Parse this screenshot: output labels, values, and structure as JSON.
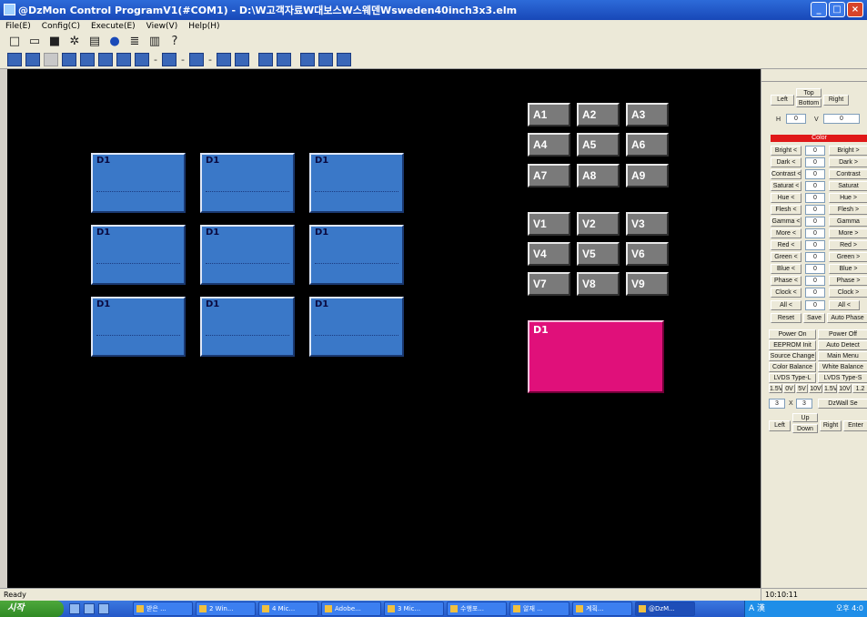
{
  "window": {
    "title": "@DzMon Control ProgramV1(#COM1) - D:\\W고객자료W대보스W스웨덴Wsweden40inch3x3.elm",
    "controls": [
      "_",
      "□",
      "×"
    ]
  },
  "menu": [
    "File(E)",
    "Config(C)",
    "Execute(E)",
    "View(V)",
    "Help(H)"
  ],
  "toolbar1_icons": [
    "new-icon",
    "open-icon",
    "save-icon",
    "tools-icon",
    "window-icon",
    "record-icon",
    "screen-icon",
    "monitor-icon",
    "help-icon"
  ],
  "toolbar1_glyphs": [
    "□",
    "▭",
    "■",
    "✲",
    "▤",
    "●",
    "≣",
    "▥",
    "?"
  ],
  "toolbar2": {
    "separators": [
      "-",
      "-",
      "-"
    ]
  },
  "display_panels": [
    {
      "label": "D1"
    },
    {
      "label": "D1"
    },
    {
      "label": "D1"
    },
    {
      "label": "D1"
    },
    {
      "label": "D1"
    },
    {
      "label": "D1"
    },
    {
      "label": "D1"
    },
    {
      "label": "D1"
    },
    {
      "label": "D1"
    }
  ],
  "a_grid": [
    "A1",
    "A2",
    "A3",
    "A4",
    "A5",
    "A6",
    "A7",
    "A8",
    "A9"
  ],
  "v_grid": [
    "V1",
    "V2",
    "V3",
    "V4",
    "V5",
    "V6",
    "V7",
    "V8",
    "V9"
  ],
  "selected_panel": {
    "label": "D1",
    "color": "#e0107a"
  },
  "right_panel": {
    "pos_buttons": {
      "left": "Left",
      "top": "Top",
      "bottom": "Bottom",
      "right": "Right"
    },
    "h_label": "H",
    "h_value": "0",
    "v_label": "V",
    "v_value": "0",
    "color_header": "Color",
    "adjust_rows": [
      {
        "minus": "Bright <",
        "value": "0",
        "plus": "Bright >"
      },
      {
        "minus": "Dark <",
        "value": "0",
        "plus": "Dark >"
      },
      {
        "minus": "Contrast <",
        "value": "0",
        "plus": "Contrast"
      },
      {
        "minus": "Saturat <",
        "value": "0",
        "plus": "Saturat"
      },
      {
        "minus": "Hue <",
        "value": "0",
        "plus": "Hue >"
      },
      {
        "minus": "Flesh <",
        "value": "0",
        "plus": "Flesh >"
      },
      {
        "minus": "Gamma <",
        "value": "0",
        "plus": "Gamma"
      },
      {
        "minus": "More <",
        "value": "0",
        "plus": "More >"
      },
      {
        "minus": "Red <",
        "value": "0",
        "plus": "Red >"
      },
      {
        "minus": "Green <",
        "value": "0",
        "plus": "Green >"
      },
      {
        "minus": "Blue <",
        "value": "0",
        "plus": "Blue >"
      },
      {
        "minus": "Phase <",
        "value": "0",
        "plus": "Phase >"
      },
      {
        "minus": "Clock <",
        "value": "0",
        "plus": "Clock >"
      }
    ],
    "all_minus": "All <",
    "all_value": "0",
    "all_plus": "All <",
    "reset": "Reset",
    "save": "Save",
    "auto_phase": "Auto Phase",
    "func_buttons": [
      [
        "Power On",
        "Power Off"
      ],
      [
        "EEPROM Init",
        "Auto Detect"
      ],
      [
        "Source Change",
        "Main Menu"
      ],
      [
        "Color Balance",
        "White Balance"
      ],
      [
        "LVDS Type-L",
        "LVDS Type-S"
      ]
    ],
    "volt_buttons": [
      "1.5V",
      "0V",
      "5V",
      "10V",
      "1.5V",
      "10V",
      "1.2"
    ],
    "grid_cols": "3",
    "grid_x": "X",
    "grid_rows": "3",
    "dzwall_label": "DzWall Se",
    "nav": {
      "left": "Left",
      "up": "Up",
      "down": "Down",
      "right": "Right",
      "enter": "Enter"
    }
  },
  "status": {
    "text": "Ready",
    "time": "10:10:11"
  },
  "taskbar": {
    "start": "시작",
    "tasks": [
      "받은 ...",
      "2 Win...",
      "4 Mic...",
      "Adobe...",
      "3 Mic...",
      "수행포...",
      "알재 ...",
      "계획...",
      "@DzM..."
    ],
    "tray_text": "A 漢",
    "clock": "오후 4:0"
  }
}
